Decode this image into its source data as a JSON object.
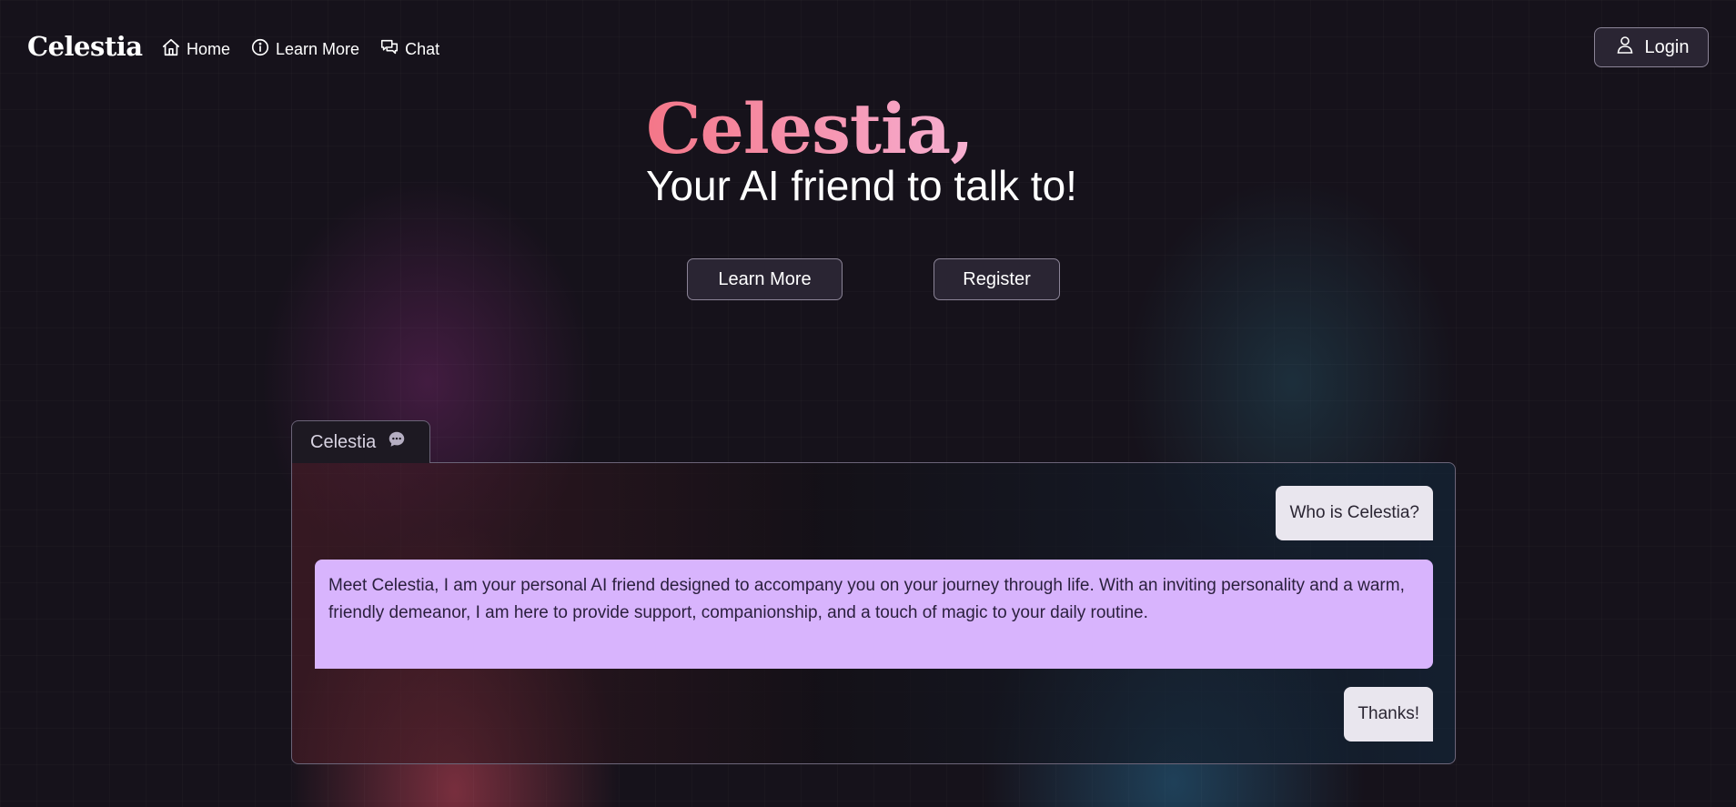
{
  "nav": {
    "brand": "Celestia",
    "links": [
      {
        "label": "Home",
        "icon": "home-icon"
      },
      {
        "label": "Learn More",
        "icon": "info-icon"
      },
      {
        "label": "Chat",
        "icon": "chat-icon"
      }
    ],
    "login_label": "Login",
    "login_icon": "user-icon"
  },
  "hero": {
    "title": "Celestia,",
    "subtitle": "Your AI friend to talk to!",
    "learn_more_label": "Learn More",
    "register_label": "Register"
  },
  "chat": {
    "tab_label": "Celestia",
    "tab_icon": "chat-bubble-icon",
    "messages": [
      {
        "role": "user",
        "text": "Who is Celestia?"
      },
      {
        "role": "assistant",
        "text": "Meet Celestia, I am your personal AI friend designed to accompany you on your journey through life. With an inviting personality and a warm, friendly demeanor, I am here to provide support, companionship, and a touch of magic to your daily routine."
      },
      {
        "role": "user",
        "text": "Thanks!"
      }
    ]
  },
  "colors": {
    "background": "#16121b",
    "title_gradient_start": "#f47688",
    "title_gradient_end": "#f7c3e6",
    "user_bubble": "#e9e6ee",
    "assistant_bubble": "#d8b4fd",
    "button_bg": "#2a2533",
    "button_border": "#8b8497"
  }
}
